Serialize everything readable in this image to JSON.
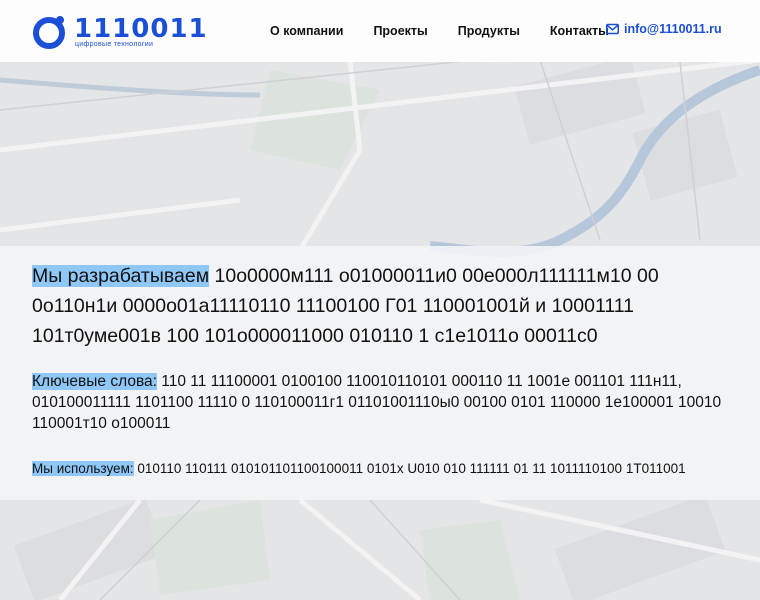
{
  "header": {
    "logo_text": "1110011",
    "logo_tagline": "цифровые технологии",
    "nav": [
      {
        "label": "О компании"
      },
      {
        "label": "Проекты"
      },
      {
        "label": "Продукты"
      },
      {
        "label": "Контакты"
      }
    ],
    "email": "info@1110011.ru"
  },
  "content": {
    "line1_label": "Мы разрабатываем",
    "line1_text": " 10о0000м111 о01000011и0 00е000л111111м10 00 0о110н1и 0000о01а11110110 11100100 Г01 110001001й и 10001111 101т0уме001в 100 101о000011000 010110 1 с1е1011о 00011с0",
    "line2_label": "Ключевые слова:",
    "line2_text": " 110 11 11100001 0100100 110010110101 000110 11 1001е 001101 111н11, 010100011111 1101100 11110 0 110100011г1 01101001110ы0 00100 0101 110000 1е100001 10010 110001т10 о100011",
    "line3_label": "Мы используем:",
    "line3_text": " 010110 110111 010101101100100011 0101х U010 010 111111 01 11 1011110100 1T011001"
  },
  "colors": {
    "brand": "#1a4fd6",
    "highlight": "#8fc8f8"
  }
}
